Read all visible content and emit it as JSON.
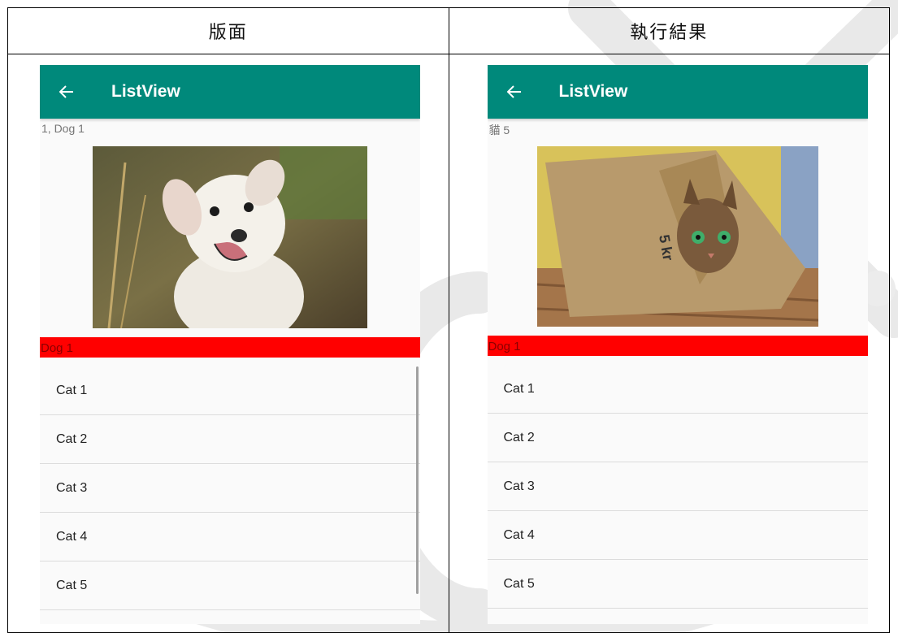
{
  "doc": {
    "col_layout": "版面",
    "col_result": "執行結果"
  },
  "layout_panel": {
    "app_title": "ListView",
    "caption": "1, Dog 1",
    "image_label": "dog-photo",
    "red_label": "Dog 1",
    "items": [
      "Cat 1",
      "Cat 2",
      "Cat 3",
      "Cat 4",
      "Cat 5"
    ]
  },
  "result_panel": {
    "app_title": "ListView",
    "caption": "貓 5",
    "image_label": "cat-in-paper-bag-photo",
    "red_label": "Dog 1",
    "items": [
      "Cat 1",
      "Cat 2",
      "Cat 3",
      "Cat 4",
      "Cat 5"
    ]
  },
  "colors": {
    "appbar": "#00897b",
    "red_bar": "#ff0000",
    "watermark": "#e6e6e6"
  }
}
